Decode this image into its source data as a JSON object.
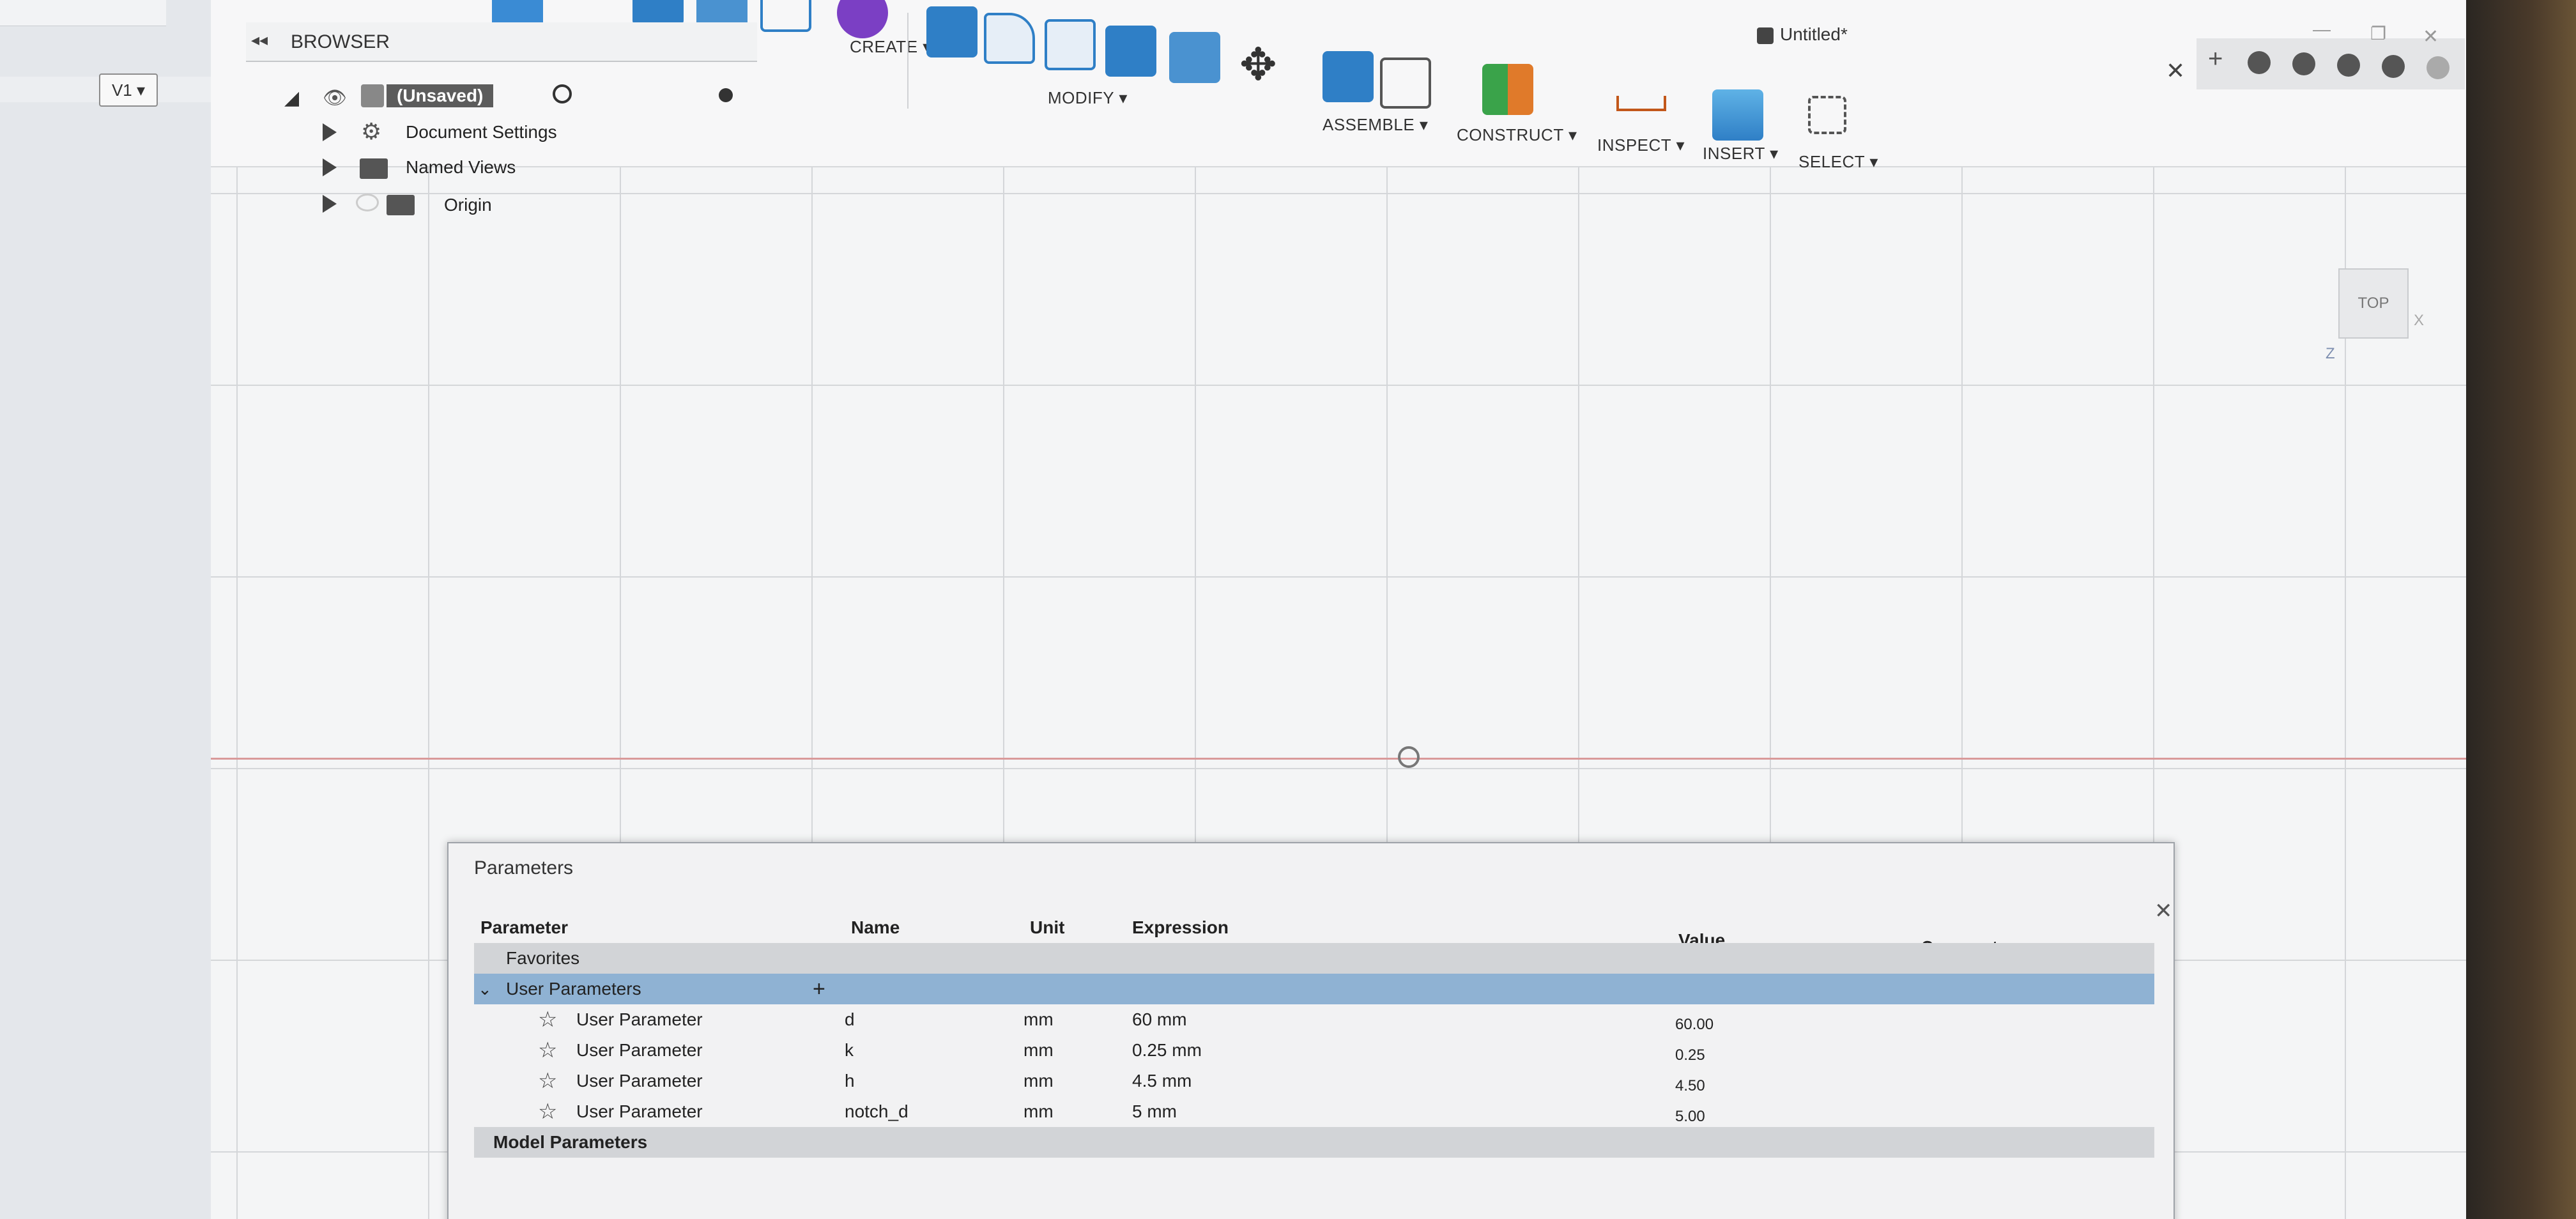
{
  "app": {
    "version_label": "V1",
    "window_title": "Untitled*"
  },
  "browser": {
    "title": "BROWSER",
    "root": "(Unsaved)",
    "items": [
      {
        "label": "Document Settings",
        "icon": "gear-icon"
      },
      {
        "label": "Named Views",
        "icon": "folder-icon"
      },
      {
        "label": "Origin",
        "icon": "folder-icon"
      }
    ]
  },
  "toolbar": {
    "groups": [
      {
        "label": "CREATE ▾"
      },
      {
        "label": "MODIFY ▾"
      },
      {
        "label": "ASSEMBLE ▾"
      },
      {
        "label": "CONSTRUCT ▾"
      },
      {
        "label": "INSPECT ▾"
      },
      {
        "label": "INSERT ▾"
      },
      {
        "label": "SELECT ▾"
      }
    ]
  },
  "viewcube": {
    "face": "TOP",
    "axis_x": "X",
    "axis_z": "Z"
  },
  "parameters_dialog": {
    "title": "Parameters",
    "columns": [
      "Parameter",
      "Name",
      "Unit",
      "Expression",
      "Value",
      "Comments"
    ],
    "groups": [
      {
        "label": "Favorites"
      },
      {
        "label": "User Parameters",
        "add": "+"
      },
      {
        "label": "Model Parameters"
      }
    ],
    "rows": [
      {
        "parameter": "User Parameter",
        "name": "d",
        "unit": "mm",
        "expression": "60 mm",
        "value": "60.00"
      },
      {
        "parameter": "User Parameter",
        "name": "k",
        "unit": "mm",
        "expression": "0.25 mm",
        "value": "0.25"
      },
      {
        "parameter": "User Parameter",
        "name": "h",
        "unit": "mm",
        "expression": "4.5 mm",
        "value": "4.50"
      },
      {
        "parameter": "User Parameter",
        "name": "notch_d",
        "unit": "mm",
        "expression": "5 mm",
        "value": "5.00"
      }
    ]
  },
  "colors": {
    "selected_group": "#8fb2d3",
    "axis_red": "#d99a9a",
    "tool_blue": "#2f7fc6"
  }
}
